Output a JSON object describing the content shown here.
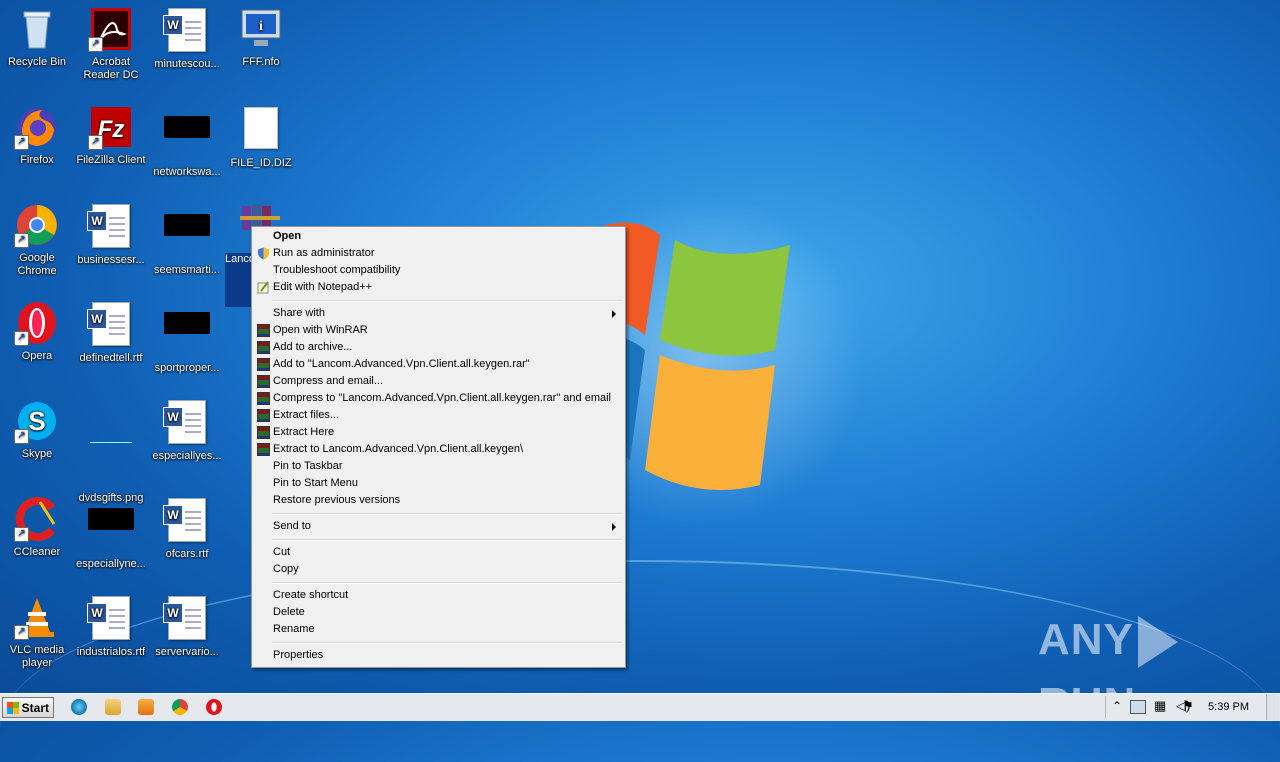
{
  "desktop": {
    "icons": [
      {
        "label": "Recycle Bin",
        "icon": "recycle-bin-icon"
      },
      {
        "label": "Acrobat Reader DC",
        "icon": "acrobat-icon"
      },
      {
        "label": "minutescou...",
        "icon": "word-doc-icon"
      },
      {
        "label": "FFF.nfo",
        "icon": "nfo-icon"
      },
      {
        "label": "Firefox",
        "icon": "firefox-icon"
      },
      {
        "label": "FileZilla Client",
        "icon": "filezilla-icon"
      },
      {
        "label": "networkswa...",
        "icon": "redacted-icon"
      },
      {
        "label": "FILE_ID.DIZ",
        "icon": "blank-file-icon"
      },
      {
        "label": "Google Chrome",
        "icon": "chrome-icon"
      },
      {
        "label": "businessesr...",
        "icon": "word-doc-icon"
      },
      {
        "label": "seemsmarti...",
        "icon": "redacted-icon"
      },
      {
        "label": "Opera",
        "icon": "opera-icon"
      },
      {
        "label": "definedtell.rtf",
        "icon": "word-doc-icon"
      },
      {
        "label": "sportproper...",
        "icon": "redacted-icon"
      },
      {
        "label": "Skype",
        "icon": "skype-icon"
      },
      {
        "label": "dvdsgifts.png",
        "icon": "image-icon"
      },
      {
        "label": "especiallyes...",
        "icon": "word-doc-icon"
      },
      {
        "label": "CCleaner",
        "icon": "ccleaner-icon"
      },
      {
        "label": "especiallyne...",
        "icon": "redacted-icon"
      },
      {
        "label": "ofcars.rtf",
        "icon": "word-doc-icon"
      },
      {
        "label": "VLC media player",
        "icon": "vlc-icon"
      },
      {
        "label": "industrialos.rtf",
        "icon": "word-doc-icon"
      },
      {
        "label": "servervario...",
        "icon": "word-doc-icon"
      }
    ],
    "selected_file_label": "Lancom.Advanced.Vpn.Client.all.keygen"
  },
  "context_menu": {
    "items": [
      {
        "label": "Open"
      },
      {
        "label": "Run as administrator"
      },
      {
        "label": "Troubleshoot compatibility"
      },
      {
        "label": "Edit with Notepad++"
      },
      {
        "label": "Share with"
      },
      {
        "label": "Open with WinRAR"
      },
      {
        "label": "Add to archive..."
      },
      {
        "label": "Add to \"Lancom.Advanced.Vpn.Client.all.keygen.rar\""
      },
      {
        "label": "Compress and email..."
      },
      {
        "label": "Compress to \"Lancom.Advanced.Vpn.Client.all.keygen.rar\" and email"
      },
      {
        "label": "Extract files..."
      },
      {
        "label": "Extract Here"
      },
      {
        "label": "Extract to Lancom.Advanced.Vpn.Client.all.keygen\\"
      },
      {
        "label": "Pin to Taskbar"
      },
      {
        "label": "Pin to Start Menu"
      },
      {
        "label": "Restore previous versions"
      },
      {
        "label": "Send to"
      },
      {
        "label": "Cut"
      },
      {
        "label": "Copy"
      },
      {
        "label": "Create shortcut"
      },
      {
        "label": "Delete"
      },
      {
        "label": "Rename"
      },
      {
        "label": "Properties"
      }
    ]
  },
  "taskbar": {
    "start_label": "Start",
    "pinned": [
      "internet-explorer-icon",
      "explorer-icon",
      "media-player-icon",
      "chrome-icon",
      "opera-icon"
    ],
    "clock": "5:39 PM"
  },
  "watermark": {
    "left": "ANY",
    "right": "RUN"
  },
  "colors": {
    "desktop": "#1f7fd4",
    "menu_bg": "#f0f0f0",
    "taskbar": "#e5e9ee"
  }
}
